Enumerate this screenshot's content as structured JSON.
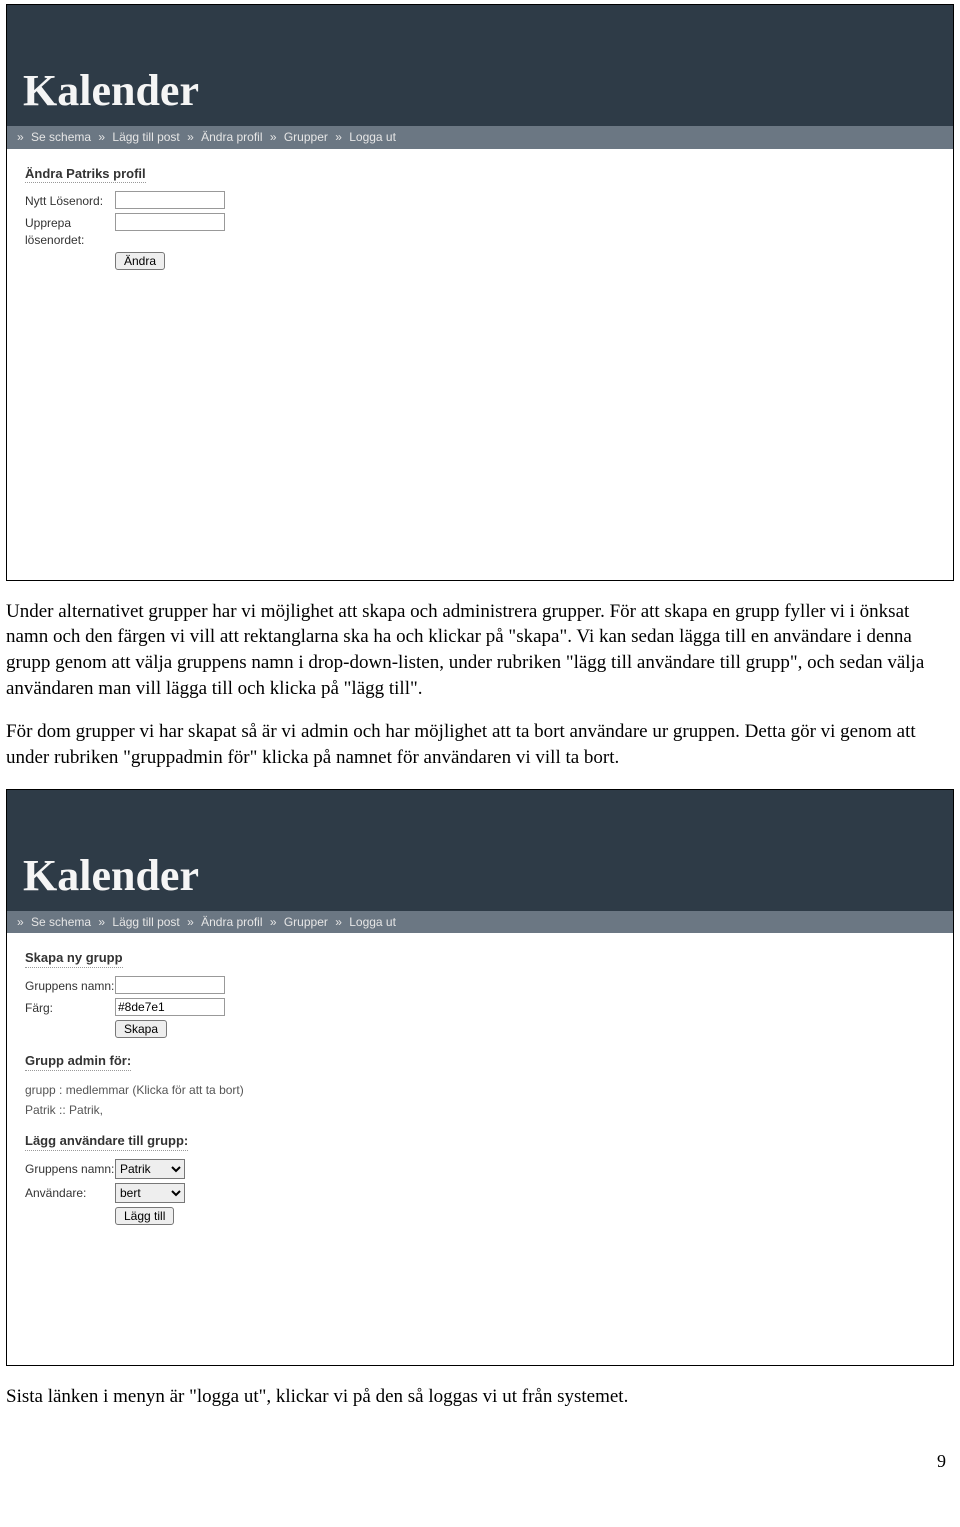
{
  "app": {
    "title": "Kalender",
    "nav": [
      "Se schema",
      "Lägg till post",
      "Ändra profil",
      "Grupper",
      "Logga ut"
    ]
  },
  "shot1": {
    "section_title": "Ändra Patriks profil",
    "row1_label": "Nytt Lösenord:",
    "row2_label": "Upprepa lösenordet:",
    "button": "Ändra"
  },
  "para1": "Under alternativet grupper har vi möjlighet att skapa och administrera grupper. För att skapa en grupp fyller vi i önksat namn och den färgen vi vill att rektanglarna ska ha och klickar på \"skapa\". Vi kan sedan lägga till en användare i denna grupp genom att välja gruppens namn i drop-down-listen, under rubriken \"lägg till användare till grupp\", och sedan välja användaren man vill lägga till och klicka på \"lägg till\".",
  "para2": "För dom grupper vi har skapat så är vi admin och har möjlighet att ta bort användare ur gruppen. Detta gör vi genom att under rubriken \"gruppadmin för\" klicka på namnet för användaren vi vill ta bort.",
  "shot2": {
    "sec_create": "Skapa ny grupp",
    "create_name_label": "Gruppens namn:",
    "create_color_label": "Färg:",
    "create_color_value": "#8de7e1",
    "create_button": "Skapa",
    "sec_admin": "Grupp admin för:",
    "admin_line1": "grupp : medlemmar (Klicka för att ta bort)",
    "admin_line2": "Patrik :: Patrik,",
    "sec_add": "Lägg användare till grupp:",
    "add_group_label": "Gruppens namn:",
    "add_group_selected": "Patrik",
    "add_user_label": "Användare:",
    "add_user_selected": "bert",
    "add_button": "Lägg till"
  },
  "para3": "Sista länken i menyn är \"logga ut\", klickar vi på den så loggas vi ut från systemet.",
  "page_number": "9"
}
